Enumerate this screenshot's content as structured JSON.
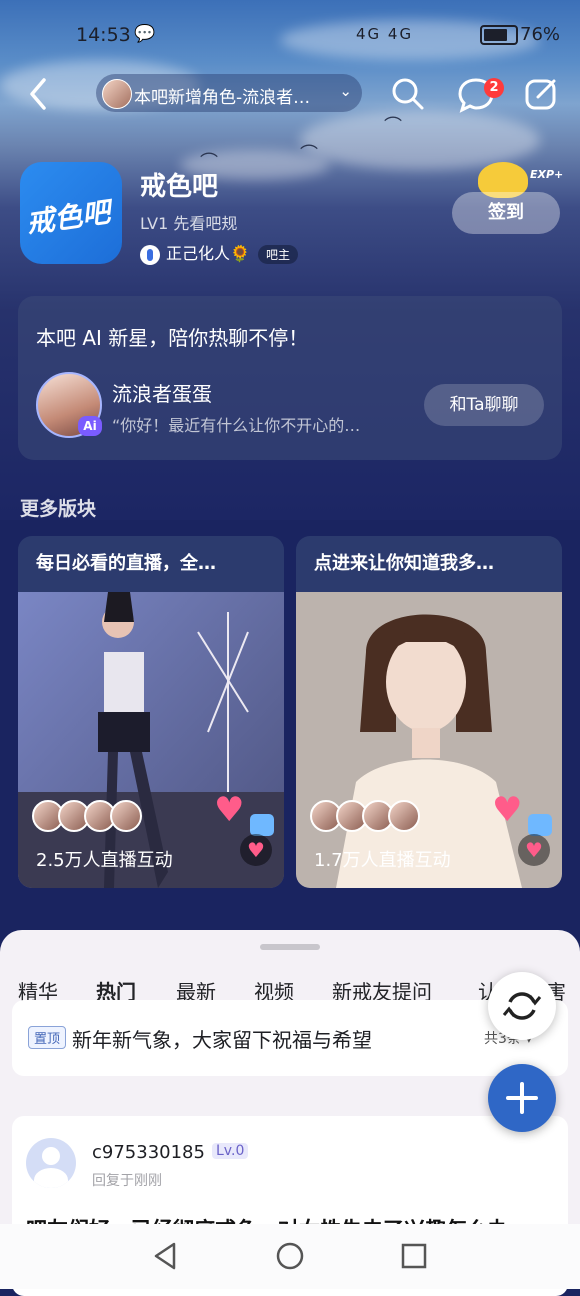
{
  "status_bar": {
    "time": "14:53",
    "network": "4G 4G",
    "battery_pct": "76%",
    "battery_level": 0.76
  },
  "nav": {
    "title": "本吧新增角色-流浪者…",
    "notification_count": "2"
  },
  "forum": {
    "logo_text": "戒色吧",
    "name": "戒色吧",
    "level_text": "LV1 先看吧规",
    "owner_name": "正己化人🌻",
    "owner_tag": "吧主",
    "signin_label": "签到",
    "exp_label": "EXP+"
  },
  "ai_card": {
    "title": "本吧 AI 新星，陪你热聊不停！",
    "ai_badge": "Ai",
    "name": "流浪者蛋蛋",
    "message": "“你好！最近有什么让你不开心的…",
    "chat_button": "和Ta聊聊"
  },
  "more_boards": {
    "title": "更多版块",
    "boards": [
      {
        "title": "每日必看的直播，全…",
        "count": "2.5万人直播互动"
      },
      {
        "title": "点进来让你知道我多…",
        "count": "1.7万人直播互动"
      }
    ]
  },
  "tabs": [
    "精华",
    "热门",
    "最新",
    "视频",
    "新戒友提问",
    "认",
    "害"
  ],
  "active_tab": "热门",
  "pinned": {
    "tag": "置顶",
    "title": "新年新气象，大家留下祝福与希望",
    "more": "共3条 ▾"
  },
  "post": {
    "username": "c975330185",
    "level": "Lv.0",
    "meta": "回复于刚刚",
    "text": "吧友们好，已经彻底戒色，对女性失去了兴趣怎么办"
  },
  "colors": {
    "accent": "#2f67c6",
    "badge_red": "#ff3b3b",
    "background": "#1a2460"
  }
}
